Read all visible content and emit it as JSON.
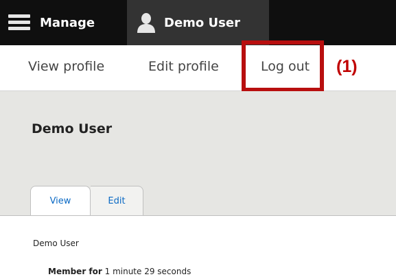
{
  "toolbar": {
    "manage_label": "Manage",
    "user_label": "Demo User",
    "icons": {
      "manage": "hamburger-icon",
      "user": "user-icon"
    }
  },
  "tray": {
    "view_profile": "View profile",
    "edit_profile": "Edit profile",
    "log_out": "Log out"
  },
  "annotation": {
    "label": "(1)",
    "color": "#c00000"
  },
  "page": {
    "title": "Demo User",
    "tabs": [
      {
        "label": "View",
        "active": true
      },
      {
        "label": "Edit",
        "active": false
      }
    ]
  },
  "content": {
    "username": "Demo User",
    "member_label": "Member for",
    "member_value": "1 minute 29 seconds"
  },
  "colors": {
    "toolbar_bg": "#0f0f0f",
    "active_toolbar_item_bg": "#333333",
    "header_band_bg": "#e6e6e3",
    "tab_link": "#0a69c4",
    "highlight": "#b80f0f"
  }
}
